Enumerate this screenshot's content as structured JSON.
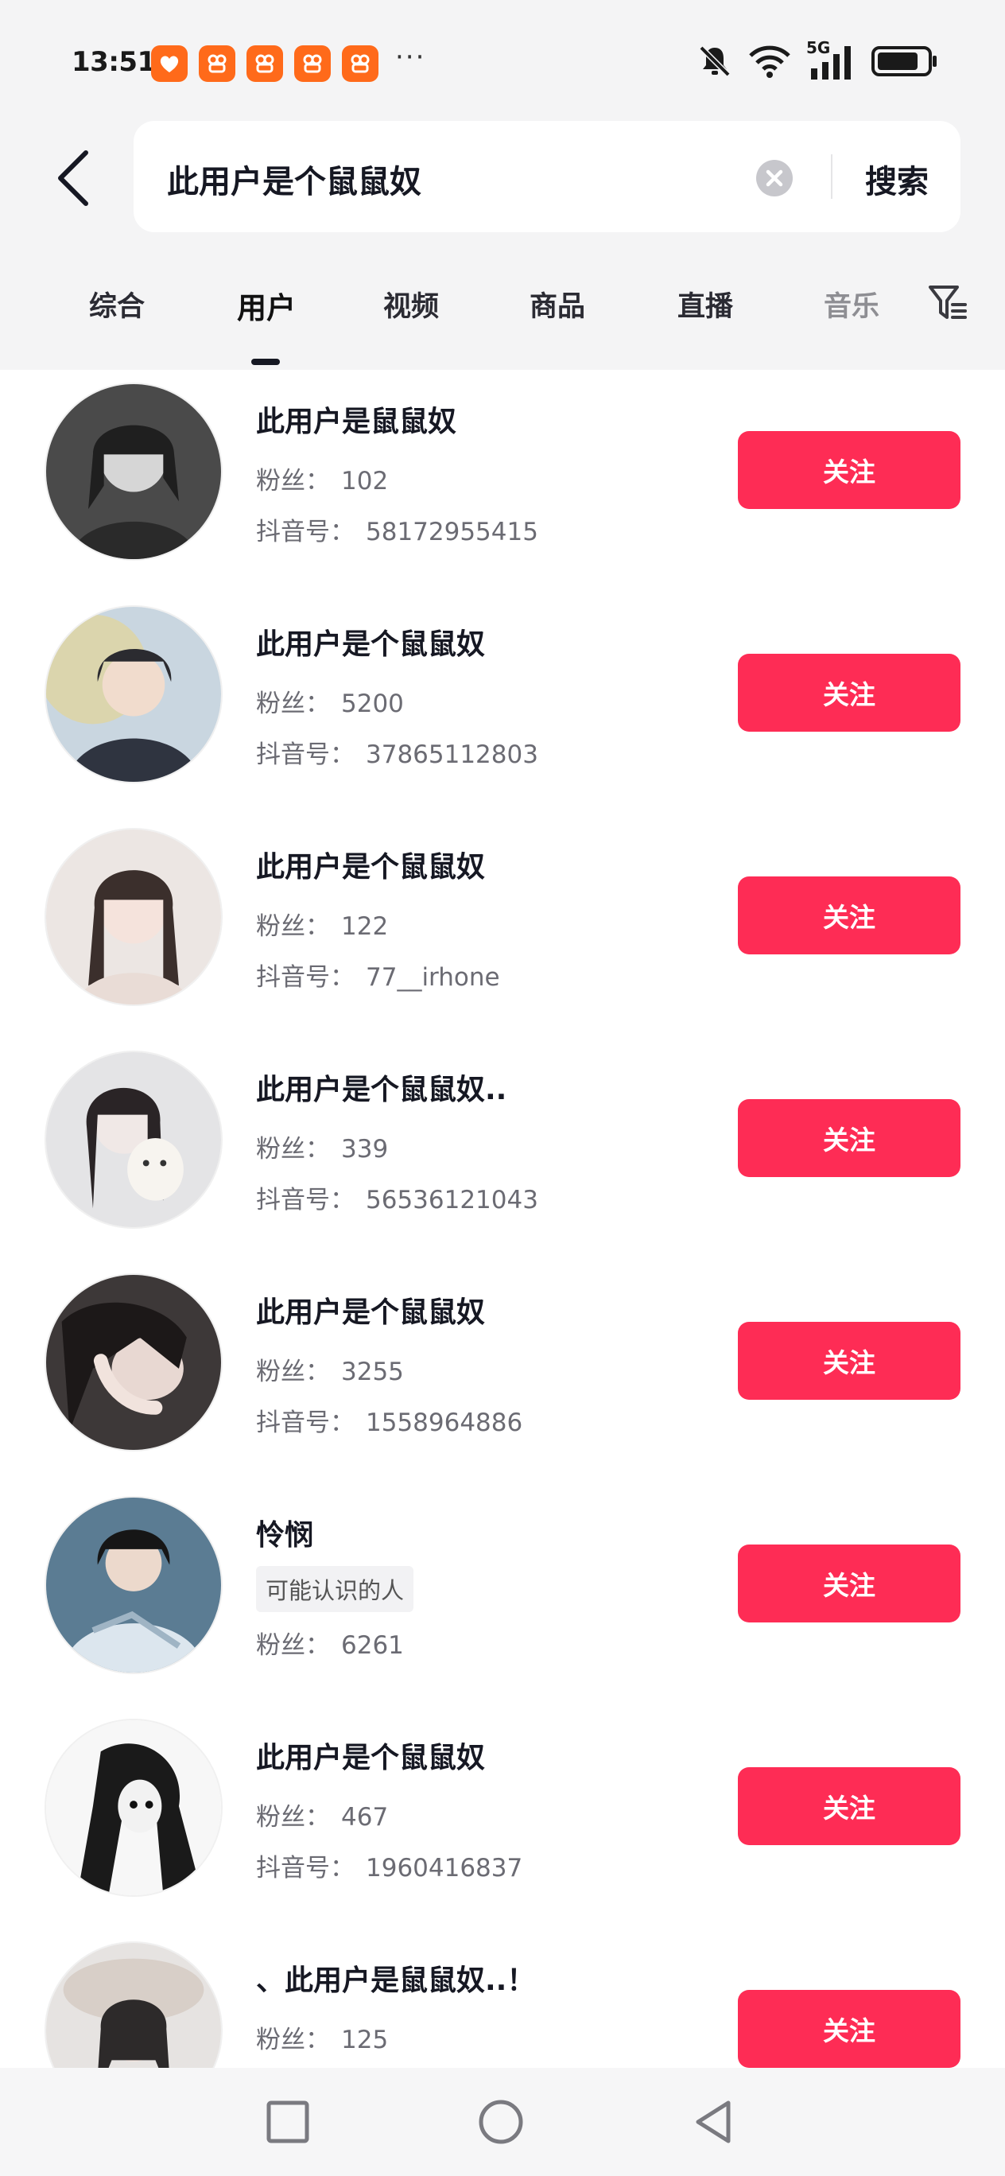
{
  "status_bar": {
    "time": "13:51",
    "more_dots": "···",
    "network_label": "5G",
    "notification_icons": [
      "heart-app-icon",
      "app-icon",
      "app-icon",
      "app-icon",
      "app-icon"
    ]
  },
  "search": {
    "query": "此用户是个鼠鼠奴",
    "submit_label": "搜索"
  },
  "tabs": [
    {
      "label": "综合",
      "active": false
    },
    {
      "label": "用户",
      "active": true
    },
    {
      "label": "视频",
      "active": false
    },
    {
      "label": "商品",
      "active": false
    },
    {
      "label": "直播",
      "active": false
    },
    {
      "label": "音乐",
      "active": false
    }
  ],
  "labels": {
    "fans": "粉丝：",
    "douyin_id": "抖音号："
  },
  "users": [
    {
      "name": "此用户是鼠鼠奴",
      "fans": "102",
      "douyin_id": "58172955415",
      "follow_label": "关注"
    },
    {
      "name": "此用户是个鼠鼠奴",
      "fans": "5200",
      "douyin_id": "37865112803",
      "follow_label": "关注"
    },
    {
      "name": "此用户是个鼠鼠奴",
      "fans": "122",
      "douyin_id": "77__irhone",
      "follow_label": "关注"
    },
    {
      "name": "此用户是个鼠鼠奴..",
      "fans": "339",
      "douyin_id": "56536121043",
      "follow_label": "关注"
    },
    {
      "name": "此用户是个鼠鼠奴",
      "fans": "3255",
      "douyin_id": "1558964886",
      "follow_label": "关注"
    },
    {
      "name": "怜悯",
      "tag": "可能认识的人",
      "fans": "6261",
      "follow_label": "关注"
    },
    {
      "name": "此用户是个鼠鼠奴",
      "fans": "467",
      "douyin_id": "1960416837",
      "follow_label": "关注"
    },
    {
      "name": "、此用户是鼠鼠奴..！",
      "fans": "125",
      "follow_label": "关注"
    }
  ],
  "colors": {
    "accent": "#fe2c55",
    "header_bg": "#f4f4f5",
    "text_primary": "#161823",
    "text_secondary": "#6b6b73"
  }
}
